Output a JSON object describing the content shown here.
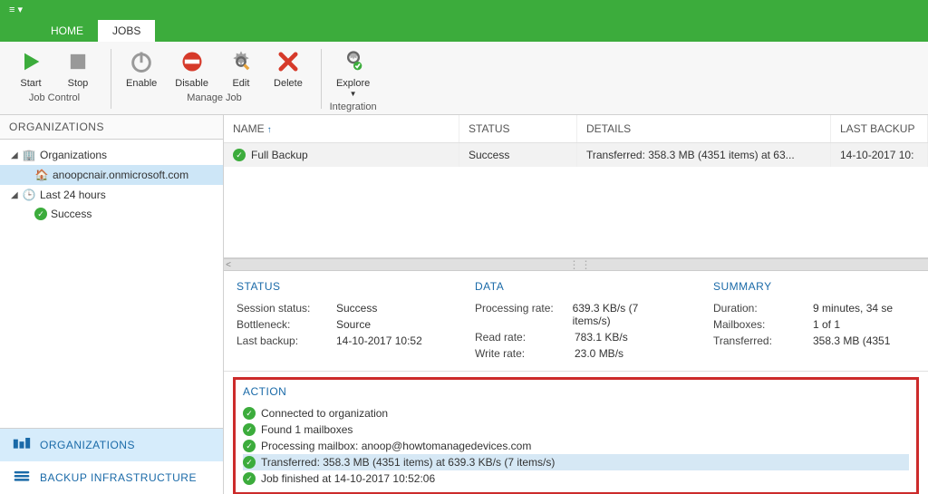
{
  "tabs": {
    "home": "HOME",
    "jobs": "JOBS"
  },
  "ribbon": {
    "start": "Start",
    "stop": "Stop",
    "enable": "Enable",
    "disable": "Disable",
    "edit": "Edit",
    "delete": "Delete",
    "explore": "Explore",
    "job_control": "Job Control",
    "manage_job": "Manage Job",
    "integration": "Integration"
  },
  "leftnav": {
    "title": "ORGANIZATIONS",
    "organizations": "Organizations",
    "org_child": "anoopcnair.onmicrosoft.com",
    "last24": "Last 24 hours",
    "success": "Success",
    "bottom_orgs": "ORGANIZATIONS",
    "bottom_backup": "BACKUP INFRASTRUCTURE"
  },
  "jobs": {
    "headers": {
      "name": "NAME",
      "status": "STATUS",
      "details": "DETAILS",
      "last": "LAST BACKUP"
    },
    "row": {
      "name": "Full Backup",
      "status": "Success",
      "details": "Transferred: 358.3 MB (4351 items) at 63...",
      "last": "14-10-2017 10:"
    }
  },
  "panels": {
    "status": {
      "title": "STATUS",
      "session_status_k": "Session status:",
      "session_status_v": "Success",
      "bottleneck_k": "Bottleneck:",
      "bottleneck_v": "Source",
      "last_backup_k": "Last backup:",
      "last_backup_v": "14-10-2017 10:52"
    },
    "data": {
      "title": "DATA",
      "proc_rate_k": "Processing rate:",
      "proc_rate_v": "639.3 KB/s (7 items/s)",
      "read_rate_k": "Read rate:",
      "read_rate_v": "783.1 KB/s",
      "write_rate_k": "Write rate:",
      "write_rate_v": "23.0 MB/s"
    },
    "summary": {
      "title": "SUMMARY",
      "duration_k": "Duration:",
      "duration_v": "9 minutes, 34 se",
      "mailboxes_k": "Mailboxes:",
      "mailboxes_v": "1 of 1",
      "transferred_k": "Transferred:",
      "transferred_v": "358.3 MB (4351"
    }
  },
  "action": {
    "title": "ACTION",
    "items": [
      "Connected to organization",
      "Found 1 mailboxes",
      "Processing mailbox: anoop@howtomanagedevices.com",
      "Transferred: 358.3 MB (4351 items) at 639.3 KB/s (7 items/s)",
      "Job finished at 14-10-2017 10:52:06"
    ]
  }
}
